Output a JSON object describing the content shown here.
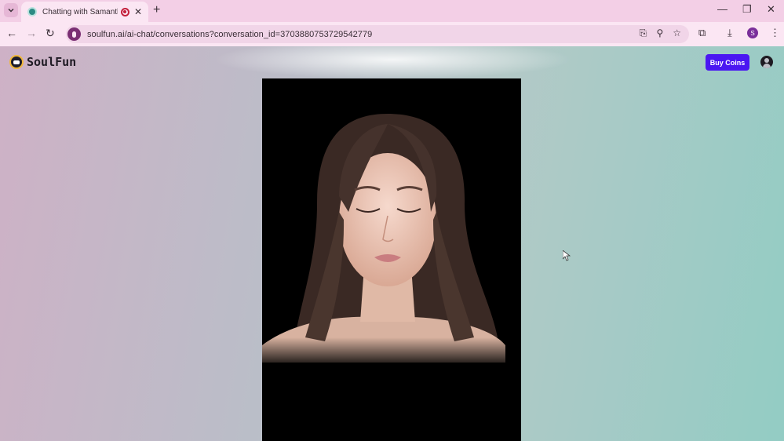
{
  "browser": {
    "tab_title": "Chatting with Samantha, yo",
    "new_tab_label": "+",
    "url": "soulfun.ai/ai-chat/conversations?conversation_id=3703880753729542779",
    "profile_initial": "S",
    "icons": [
      "tab-search-icon",
      "record-icon",
      "close-icon",
      "back-icon",
      "forward-icon",
      "reload-icon",
      "mic-icon",
      "install-icon",
      "zoom-icon",
      "star-icon",
      "extensions-icon",
      "download-icon",
      "menu-icon",
      "minimize-icon",
      "restore-icon",
      "window-close-icon"
    ]
  },
  "page": {
    "logo_text": "SoulFun",
    "buy_coins_label": "Buy Coins",
    "accent_color": "#4a16f2"
  }
}
